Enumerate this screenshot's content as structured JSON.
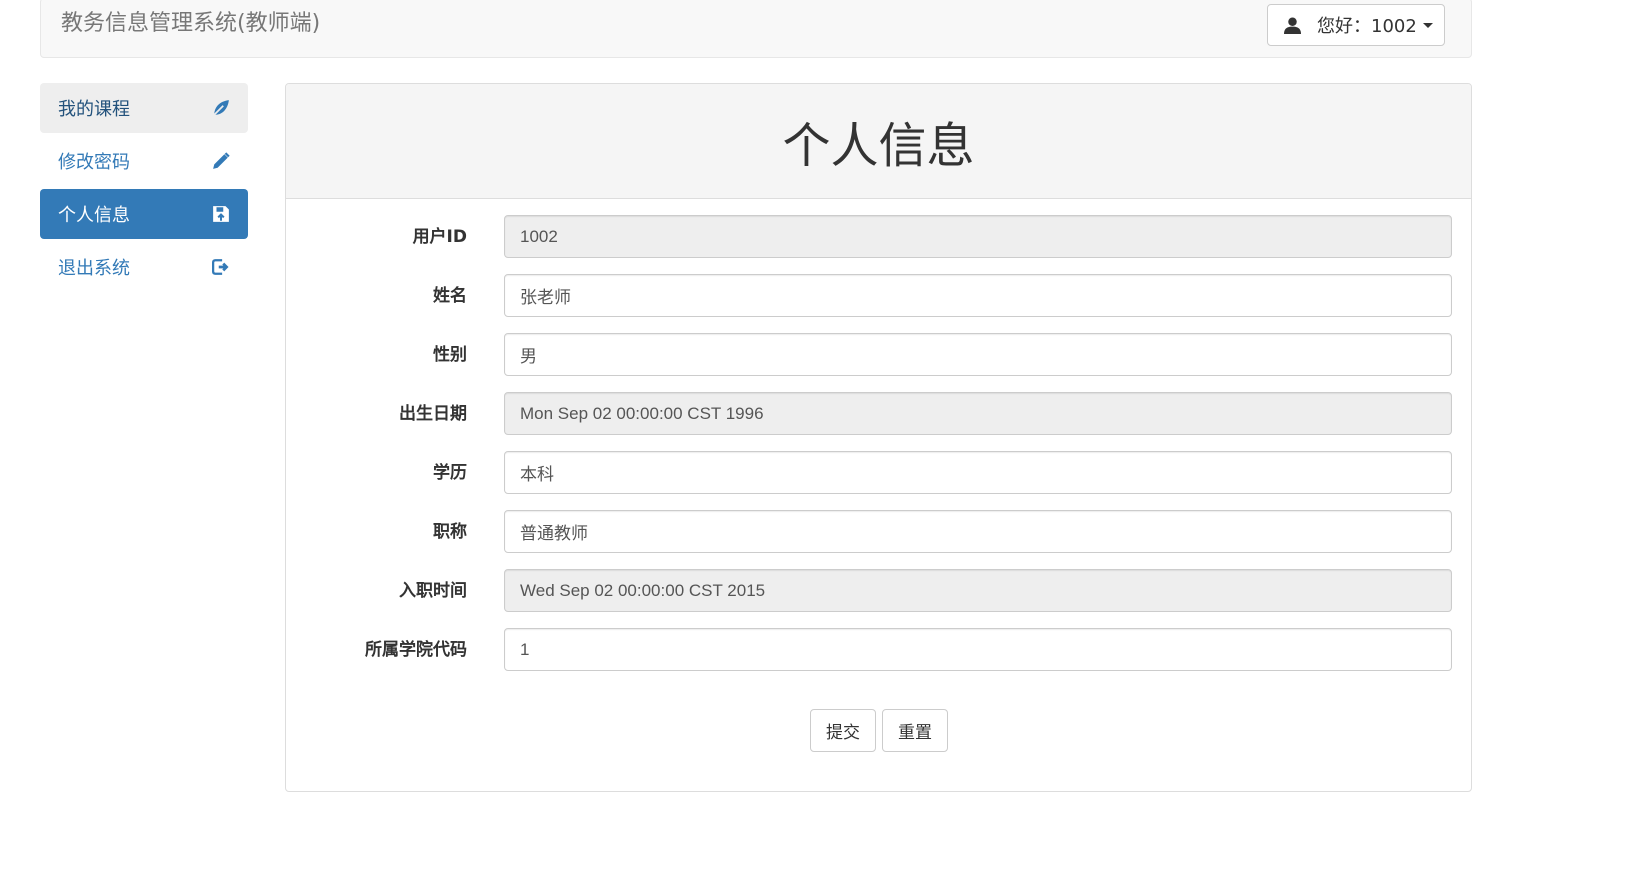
{
  "navbar": {
    "brand": "教务信息管理系统(教师端)",
    "user_greeting": "您好：1002",
    "user_icon": "user-icon"
  },
  "sidebar": {
    "items": [
      {
        "label": "我的课程",
        "icon": "leaf-icon",
        "state": "hover"
      },
      {
        "label": "修改密码",
        "icon": "pencil-icon",
        "state": "normal"
      },
      {
        "label": "个人信息",
        "icon": "save-icon",
        "state": "active"
      },
      {
        "label": "退出系统",
        "icon": "logout-icon",
        "state": "normal"
      }
    ]
  },
  "main": {
    "title": "个人信息",
    "fields": [
      {
        "label": "用户ID",
        "value": "1002",
        "readonly": true
      },
      {
        "label": "姓名",
        "value": "张老师",
        "readonly": false
      },
      {
        "label": "性别",
        "value": "男",
        "readonly": false
      },
      {
        "label": "出生日期",
        "value": "Mon Sep 02 00:00:00 CST 1996",
        "readonly": true
      },
      {
        "label": "学历",
        "value": "本科",
        "readonly": false
      },
      {
        "label": "职称",
        "value": "普通教师",
        "readonly": false
      },
      {
        "label": "入职时间",
        "value": "Wed Sep 02 00:00:00 CST 2015",
        "readonly": true
      },
      {
        "label": "所属学院代码",
        "value": "1",
        "readonly": false
      }
    ],
    "submit_label": "提交",
    "reset_label": "重置"
  },
  "colors": {
    "primary": "#337ab7",
    "readonly_bg": "#eeeeee",
    "panel_heading_bg": "#f5f5f5"
  }
}
